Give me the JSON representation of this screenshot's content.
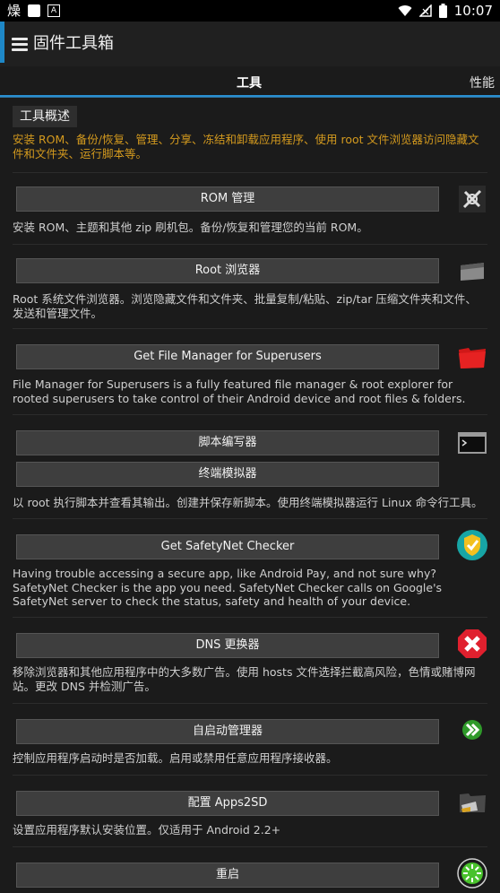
{
  "status_bar": {
    "left_glyph": "燥",
    "time": "10:07"
  },
  "app_bar": {
    "title": "固件工具箱"
  },
  "tabs": [
    {
      "label": "工具"
    },
    {
      "label": "性能"
    }
  ],
  "overview": {
    "title": "工具概述",
    "text": "安装 ROM、备份/恢复、管理、分享、冻结和卸载应用程序、使用 root 文件浏览器访问隐藏文件和文件夹、运行脚本等。"
  },
  "tools": [
    {
      "buttons": [
        "ROM 管理"
      ],
      "description": "安装 ROM、主题和其他 zip 刷机包。备份/恢复和管理您的当前 ROM。",
      "icon": "rom-manager-icon"
    },
    {
      "buttons": [
        "Root 浏览器"
      ],
      "description": "Root 系统文件浏览器。浏览隐藏文件和文件夹、批量复制/粘贴、zip/tar 压缩文件夹和文件、发送和管理文件。",
      "icon": "root-browser-icon"
    },
    {
      "buttons": [
        "Get File Manager for Superusers"
      ],
      "description": "File Manager for Superusers is a fully featured file manager & root explorer for rooted superusers to take control of their Android device and root files & folders.",
      "icon": "folder-icon"
    },
    {
      "buttons": [
        "脚本编写器",
        "终端模拟器"
      ],
      "description": "以 root 执行脚本并查看其输出。创建并保存新脚本。使用终端模拟器运行 Linux 命令行工具。",
      "icon": "terminal-icon"
    },
    {
      "buttons": [
        "Get SafetyNet Checker"
      ],
      "description": "Having trouble accessing a secure app, like Android Pay, and not sure why? SafetyNet Checker is the app you need. SafetyNet Checker calls on Google's SafetyNet server to check the status, safety and health of your device.",
      "icon": "shield-check-icon"
    },
    {
      "buttons": [
        "DNS 更换器"
      ],
      "description": "移除浏览器和其他应用程序中的大多数广告。使用 hosts 文件选择拦截高风险，色情或赌博网站。更改 DNS 并检测广告。",
      "icon": "block-x-icon"
    },
    {
      "buttons": [
        "自启动管理器"
      ],
      "description": "控制应用程序启动时是否加载。启用或禁用任意应用程序接收器。",
      "icon": "fast-forward-icon"
    },
    {
      "buttons": [
        "配置 Apps2SD"
      ],
      "description": "设置应用程序默认安装位置。仅适用于 Android 2.2+",
      "icon": "sd-card-icon"
    },
    {
      "buttons": [
        "重启"
      ],
      "description": "",
      "icon": "reboot-icon"
    }
  ],
  "colors": {
    "accent": "#2a8fd0",
    "overview_text": "#d49a1e",
    "button_bg": "#3e3e3e",
    "background": "#1b1b1b"
  }
}
